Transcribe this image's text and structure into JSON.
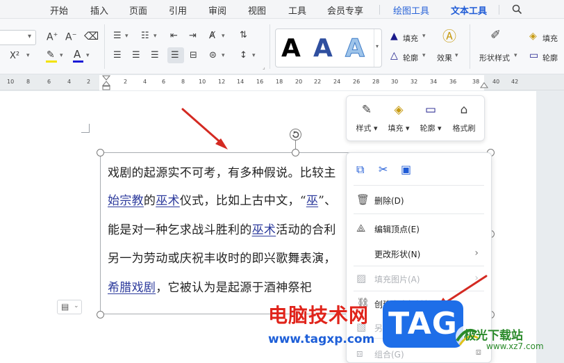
{
  "menu": {
    "tabs": [
      "开始",
      "插入",
      "页面",
      "引用",
      "审阅",
      "视图",
      "工具",
      "会员专享",
      "绘图工具",
      "文本工具"
    ],
    "active_tab": "文本工具"
  },
  "ribbon": {
    "superscript": "X²",
    "wordart_letter": "A",
    "fill_label": "填充",
    "outline_label": "轮廓",
    "effect_label": "效果",
    "shape_style_label": "形状样式",
    "fill_label_2": "填充",
    "outline_label_2": "轮廓"
  },
  "ruler": {
    "numbers": [
      "10",
      "8",
      "6",
      "4",
      "2",
      "2",
      "4",
      "6",
      "8",
      "10",
      "12",
      "14",
      "16",
      "18",
      "20",
      "22",
      "24",
      "26",
      "28",
      "30",
      "32",
      "34",
      "36",
      "38",
      "40",
      "42"
    ]
  },
  "document": {
    "line1": "戏剧的起源实不可考，有多种假说。比较主",
    "line2_link1": "始宗教",
    "line2_mid1": "的",
    "line2_link2": "巫术",
    "line2_mid2": "仪式，比如上古中文，“",
    "line2_link3": "巫",
    "line2_end": "”、",
    "line3_a": "能是对一种乞求战斗胜利的",
    "line3_link": "巫术",
    "line3_b": "活动的合利",
    "line4": "另一为劳动或庆祝丰收时的即兴歌舞表演，",
    "line5_link": "希腊戏剧",
    "line5_rest": "，它被认为是起源于酒神祭祀"
  },
  "float_toolbar": {
    "style": "样式",
    "fill": "填充",
    "outline": "轮廓",
    "format_painter": "格式刷"
  },
  "context_menu": {
    "delete": "删除(D)",
    "edit_points": "编辑顶点(E)",
    "change_shape": "更改形状(N)",
    "fill_picture": "填充图片(A)",
    "create_textbox_link": "创建文本框链接(R)",
    "save_as_picture": "另存为图片",
    "group": "组合(G)"
  },
  "watermark": {
    "site_name": "电脑技术网",
    "site_url": "www.tagxp.com",
    "tag": "TAG",
    "jg_name": "极光下载站",
    "jg_url": "www.xz7.com"
  },
  "colors": {
    "accent": "#1f5bd6",
    "arrow": "#d42a22",
    "link": "#2c3a9c"
  }
}
